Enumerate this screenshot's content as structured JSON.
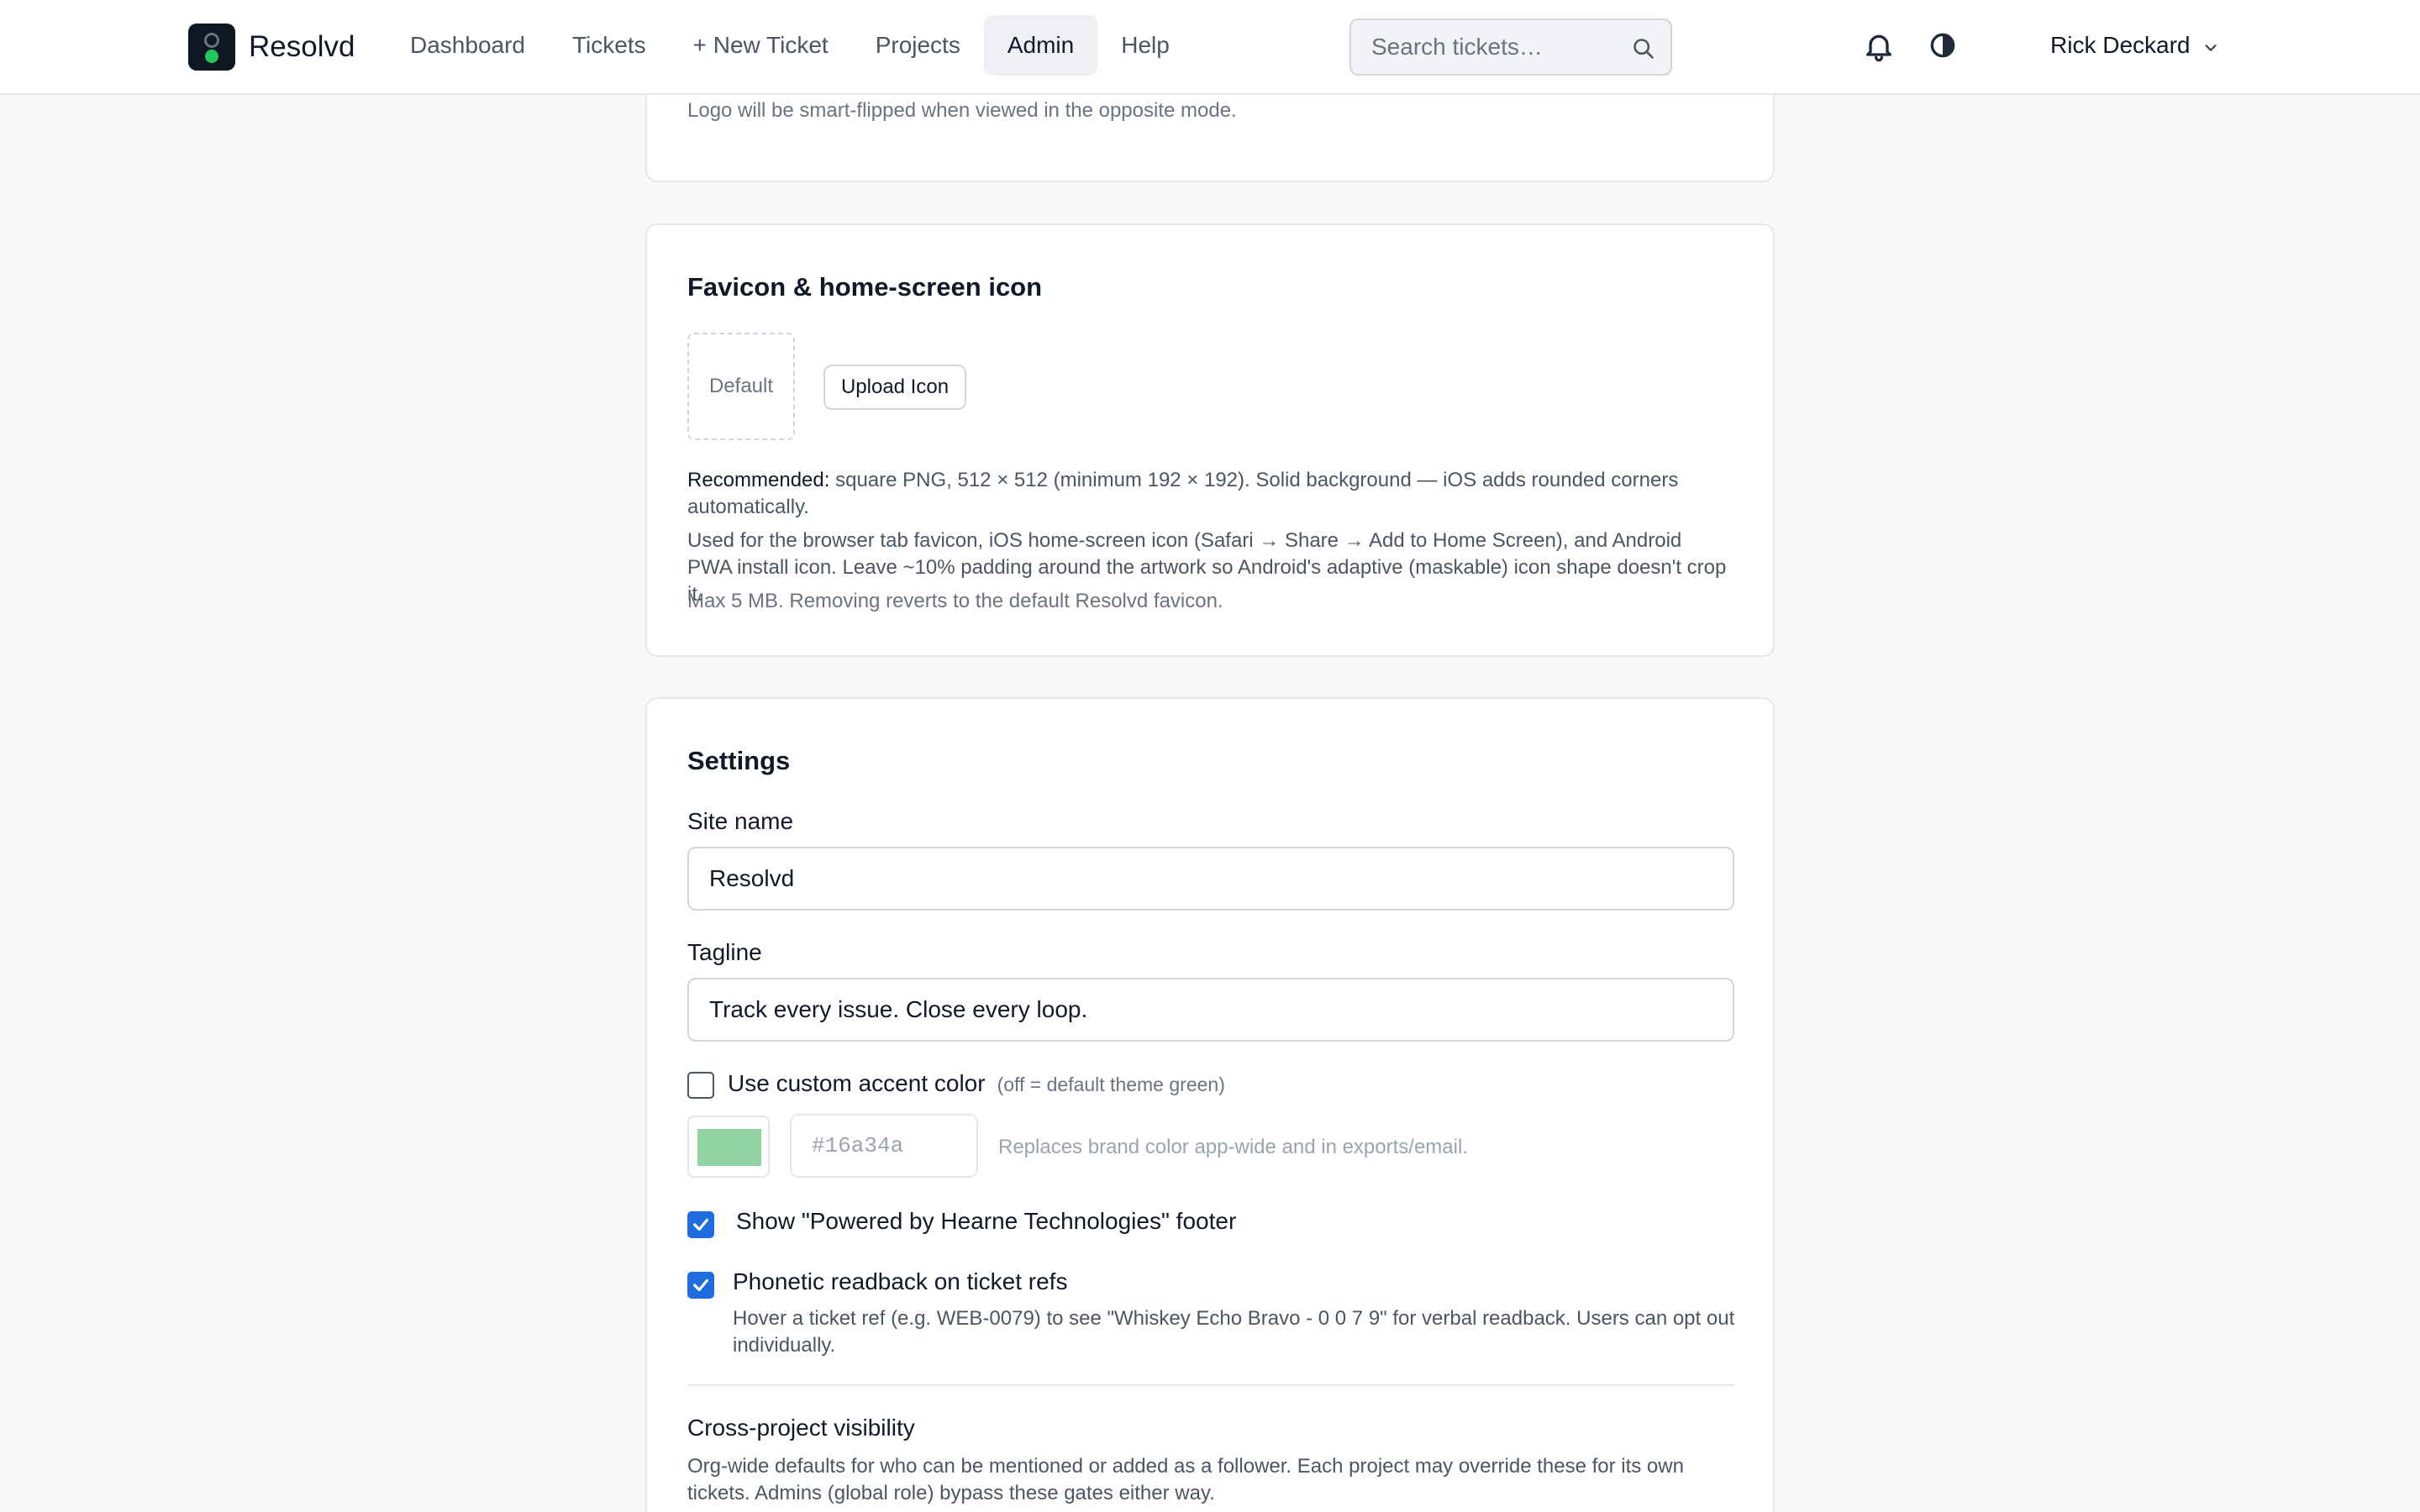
{
  "app": {
    "name": "Resolvd"
  },
  "nav": {
    "links": [
      "Dashboard",
      "Tickets",
      "+ New Ticket",
      "Projects",
      "Admin",
      "Help"
    ],
    "active": "Admin"
  },
  "search": {
    "placeholder": "Search tickets…"
  },
  "user": {
    "name": "Rick Deckard"
  },
  "icons": [
    "search-icon",
    "bell-icon",
    "contrast-icon",
    "chevron-down-icon",
    "checkmark-icon"
  ],
  "colors": {
    "accent": "#1d6ce0",
    "brand_green": "#22c55e",
    "swatch": "#8fd3a2"
  },
  "logo_section": {
    "note": "Logo will be smart-flipped when viewed in the opposite mode."
  },
  "favicon_section": {
    "title": "Favicon & home-screen icon",
    "preview_label": "Default",
    "upload_label": "Upload Icon",
    "recommended_label": "Recommended:",
    "recommended_text": "square PNG, 512 × 512 (minimum 192 × 192). Solid background — iOS adds rounded corners automatically.",
    "usage_text": "Used for the browser tab favicon, iOS home-screen icon (Safari → Share → Add to Home Screen), and Android PWA install icon. Leave ~10% padding around the artwork so Android's adaptive (maskable) icon shape doesn't crop it.",
    "max_text": "Max 5 MB. Removing reverts to the default Resolvd favicon."
  },
  "settings": {
    "title": "Settings",
    "site_name_label": "Site name",
    "site_name_value": "Resolvd",
    "tagline_label": "Tagline",
    "tagline_value": "Track every issue. Close every loop.",
    "custom_accent_label": "Use custom accent color",
    "custom_accent_hint": "(off = default theme green)",
    "custom_accent_checked": false,
    "accent_hex_placeholder": "#16a34a",
    "accent_hint": "Replaces brand color app-wide and in exports/email.",
    "powered_by_label": "Show \"Powered by Hearne Technologies\" footer",
    "powered_by_checked": true,
    "phonetic_label": "Phonetic readback on ticket refs",
    "phonetic_checked": true,
    "phonetic_desc": "Hover a ticket ref (e.g. WEB-0079) to see \"Whiskey Echo Bravo - 0 0 7 9\" for verbal readback. Users can opt out individually.",
    "cross_project_title": "Cross-project visibility",
    "cross_project_desc": "Org-wide defaults for who can be mentioned or added as a follower. Each project may override these for its own tickets. Admins (global role) bypass these gates either way."
  }
}
